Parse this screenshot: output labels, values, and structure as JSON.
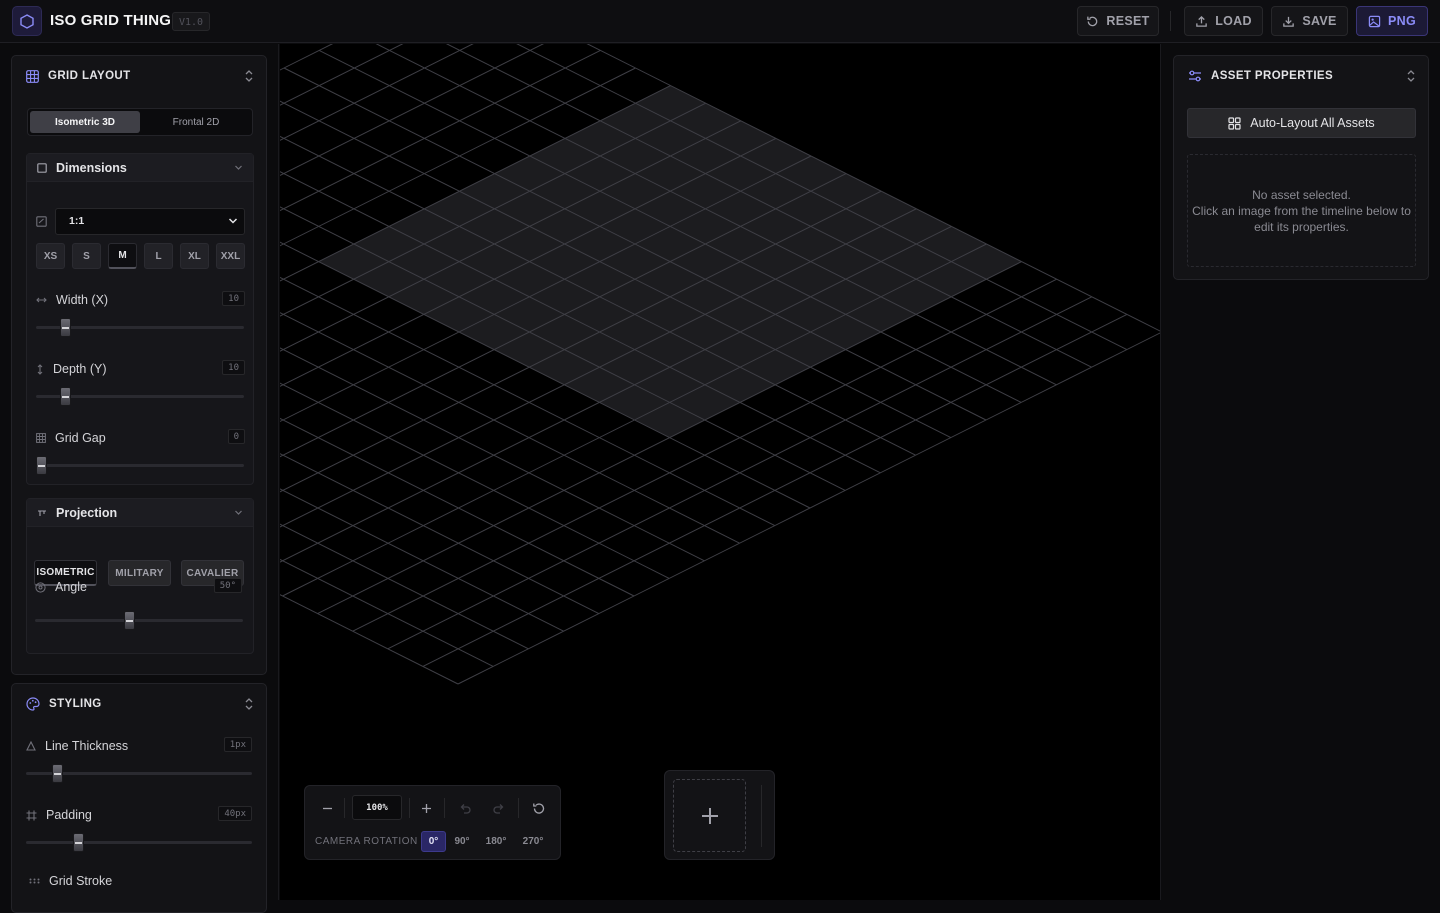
{
  "header": {
    "app_title": "ISO GRID THING",
    "version": "V1.0",
    "buttons": {
      "reset": "RESET",
      "load": "LOAD",
      "save": "SAVE",
      "png": "PNG"
    }
  },
  "grid_layout": {
    "title": "GRID LAYOUT",
    "view_modes": [
      "Isometric 3D",
      "Frontal 2D"
    ],
    "active_view_mode": "Isometric 3D",
    "dimensions": {
      "title": "Dimensions",
      "aspect_ratio": "1:1",
      "sizes": [
        "XS",
        "S",
        "M",
        "L",
        "XL",
        "XXL"
      ],
      "active_size": "M",
      "width_label": "Width (X)",
      "width_value": "10",
      "width_fraction": 0.12,
      "depth_label": "Depth (Y)",
      "depth_value": "10",
      "depth_fraction": 0.12,
      "gap_label": "Grid Gap",
      "gap_value": "0",
      "gap_fraction": 0.0
    },
    "projection": {
      "title": "Projection",
      "modes": [
        "ISOMETRIC",
        "MILITARY",
        "CAVALIER"
      ],
      "active_mode": "ISOMETRIC",
      "angle_label": "Angle",
      "angle_value": "50°",
      "angle_fraction": 0.45
    }
  },
  "styling": {
    "title": "STYLING",
    "line_thickness_label": "Line Thickness",
    "line_thickness_value": "1px",
    "line_thickness_fraction": 0.12,
    "padding_label": "Padding",
    "padding_value": "40px",
    "padding_fraction": 0.22,
    "grid_stroke_label": "Grid Stroke"
  },
  "asset_properties": {
    "title": "ASSET PROPERTIES",
    "auto_layout_label": "Auto-Layout All Assets",
    "empty_title": "No asset selected.",
    "empty_hint": "Click an image from the timeline below to edit its properties."
  },
  "toolbar": {
    "zoom": "100%",
    "camera_label": "CAMERA ROTATION",
    "rotations": [
      "0°",
      "90°",
      "180°",
      "270°"
    ],
    "active_rotation": "0°"
  },
  "colors": {
    "accent": "#6366f1",
    "grid_line": "#3f3f46",
    "highlight_fill": "#1c1c1f",
    "background": "#000000"
  }
}
